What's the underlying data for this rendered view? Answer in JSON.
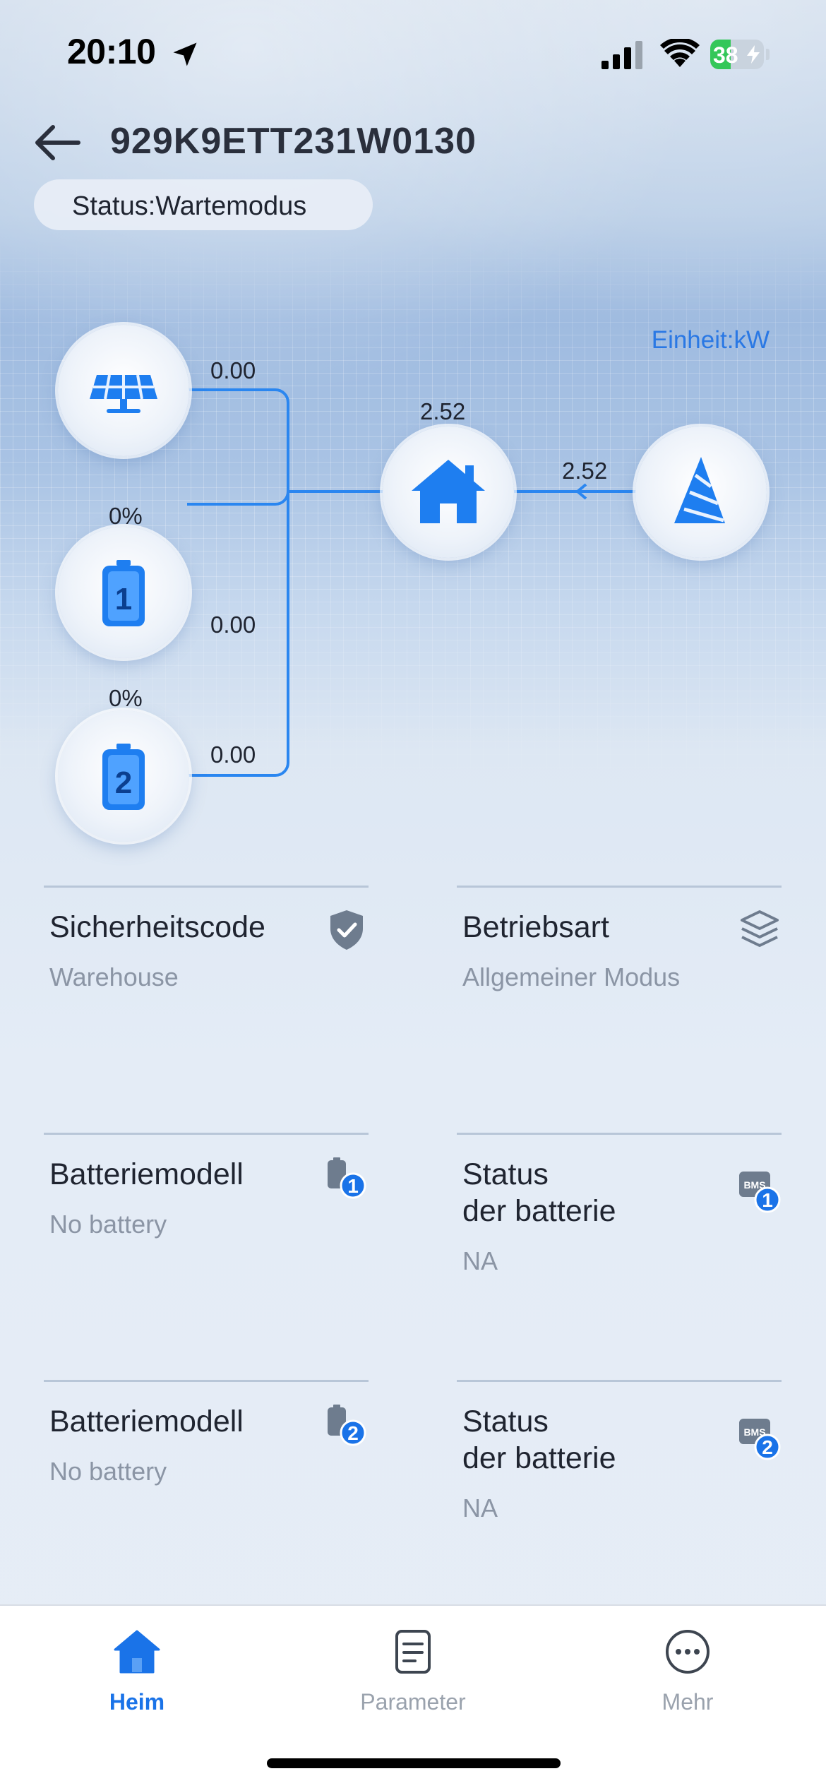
{
  "status_bar": {
    "time": "20:10",
    "battery_level": "38",
    "icons": [
      "location-arrow-icon",
      "cellular-signal-icon",
      "wifi-icon",
      "battery-charging-icon"
    ]
  },
  "header": {
    "title": "929K9ETT231W0130",
    "status": "Status:Wartemodus",
    "back_icon": "arrow-left-icon"
  },
  "flow": {
    "unit": "Einheit:kW",
    "solar_value": "0.00",
    "home_value": "2.52",
    "grid_value": "2.52",
    "battery1_soc": "0%",
    "battery1_value": "0.00",
    "battery2_soc": "0%",
    "battery2_value": "0.00",
    "colors": {
      "accent": "#1a73e8",
      "line": "#2a86f0"
    }
  },
  "cards": [
    {
      "title": "Sicherheitscode",
      "value": "Warehouse",
      "icon": "shield-check-icon"
    },
    {
      "title": "Betriebsart",
      "value": "Allgemeiner Modus",
      "icon": "layers-icon"
    },
    {
      "title": "Batteriemodell",
      "value": "No battery",
      "icon": "battery-1-icon"
    },
    {
      "title_line1": "Status",
      "title_line2": "der batterie",
      "value": "NA",
      "icon": "bms-1-icon"
    },
    {
      "title": "Batteriemodell",
      "value": "No battery",
      "icon": "battery-2-icon"
    },
    {
      "title_line1": "Status",
      "title_line2": "der batterie",
      "value": "NA",
      "icon": "bms-2-icon"
    }
  ],
  "tabbar": {
    "tabs": [
      {
        "label": "Heim",
        "icon": "home-icon",
        "active": true
      },
      {
        "label": "Parameter",
        "icon": "document-icon",
        "active": false
      },
      {
        "label": "Mehr",
        "icon": "more-icon",
        "active": false
      }
    ]
  }
}
